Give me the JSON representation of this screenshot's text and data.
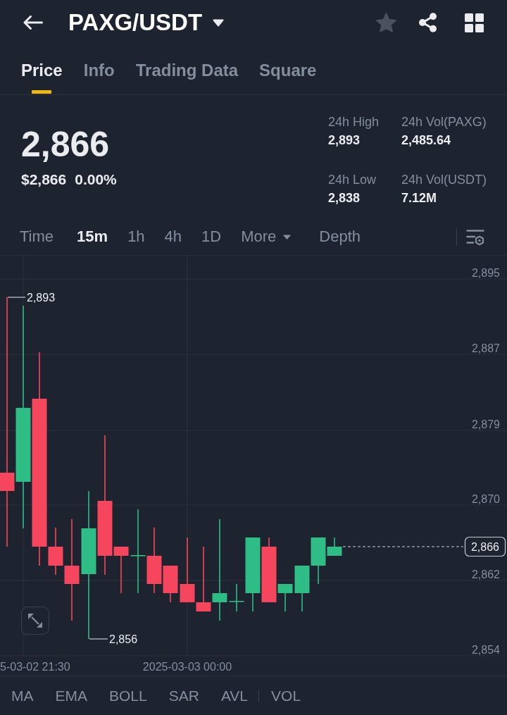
{
  "header": {
    "title": "PAXG/USDT",
    "favorite": false
  },
  "tabs": [
    {
      "label": "Price",
      "selected": true
    },
    {
      "label": "Info",
      "selected": false
    },
    {
      "label": "Trading Data",
      "selected": false
    },
    {
      "label": "Square",
      "selected": false
    }
  ],
  "ticker": {
    "last_price": "2,866",
    "usd_price": "$2,866",
    "change": "0.00%",
    "stats": [
      {
        "label": "24h High",
        "value": "2,893"
      },
      {
        "label": "24h Vol(PAXG)",
        "value": "2,485.64"
      },
      {
        "label": "24h Low",
        "value": "2,838"
      },
      {
        "label": "24h Vol(USDT)",
        "value": "7.12M"
      }
    ]
  },
  "intervals": [
    {
      "label": "Time",
      "kind": "interval",
      "selected": false
    },
    {
      "label": "15m",
      "kind": "interval",
      "selected": true
    },
    {
      "label": "1h",
      "kind": "interval",
      "selected": false
    },
    {
      "label": "4h",
      "kind": "interval",
      "selected": false
    },
    {
      "label": "1D",
      "kind": "interval",
      "selected": false
    },
    {
      "label": "More",
      "kind": "dropdown",
      "selected": false
    },
    {
      "label": "Depth",
      "kind": "view",
      "selected": false
    }
  ],
  "chart": {
    "price_axis": [
      "2,895",
      "2,887",
      "2,879",
      "2,870",
      "2,862",
      "2,854"
    ],
    "time_axis": [
      "5-03-02 21:30",
      "2025-03-03 00:00"
    ],
    "high_marker": "2,893",
    "low_marker": "2,856",
    "last_price_tag": "2,866"
  },
  "main_indicators": [
    "MA",
    "EMA",
    "BOLL",
    "SAR",
    "AVL"
  ],
  "sub_indicators": [
    "VOL"
  ]
}
